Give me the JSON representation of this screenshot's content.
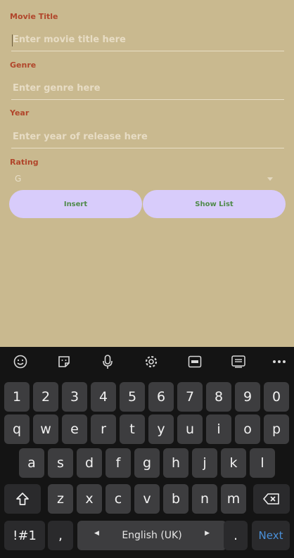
{
  "form": {
    "title_label": "Movie Title",
    "title_placeholder": "Enter movie title here",
    "genre_label": "Genre",
    "genre_placeholder": "Enter genre here",
    "year_label": "Year",
    "year_placeholder": "Enter year of release here",
    "rating_label": "Rating",
    "rating_value": "G"
  },
  "buttons": {
    "insert": "Insert",
    "show_list": "Show List"
  },
  "keyboard": {
    "toolbar_icons": [
      "emoji-icon",
      "sticker-icon",
      "microphone-icon",
      "settings-icon",
      "gif-icon",
      "clipboard-icon",
      "more-icon"
    ],
    "row1": [
      "1",
      "2",
      "3",
      "4",
      "5",
      "6",
      "7",
      "8",
      "9",
      "0"
    ],
    "row2": [
      "q",
      "w",
      "e",
      "r",
      "t",
      "y",
      "u",
      "i",
      "o",
      "p"
    ],
    "row3": [
      "a",
      "s",
      "d",
      "f",
      "g",
      "h",
      "j",
      "k",
      "l"
    ],
    "row4": [
      "z",
      "x",
      "c",
      "v",
      "b",
      "n",
      "m"
    ],
    "symbols": "!#1",
    "comma": ",",
    "space": "English (UK)",
    "period": ".",
    "action": "Next"
  },
  "colors": {
    "background": "#c9b98f",
    "label": "#b1462b",
    "button": "#d8ccfb",
    "button_text": "#4f8a4a",
    "keyboard": "#141414",
    "action": "#4a90d9"
  }
}
